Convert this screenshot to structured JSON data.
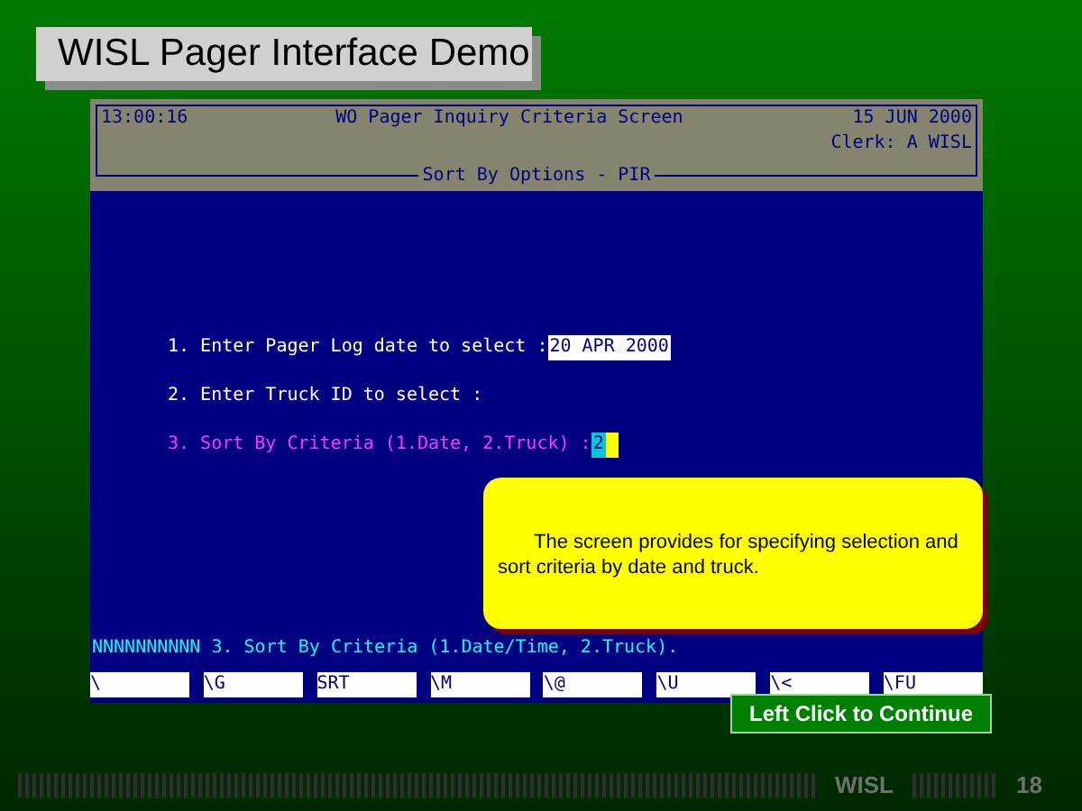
{
  "slide_title": "WISL Pager Interface Demo",
  "terminal": {
    "time": "13:00:16",
    "title": "WO Pager Inquiry Criteria Screen",
    "date": "15 JUN 2000",
    "clerk": "Clerk: A WISL",
    "section": "Sort By Options - PIR",
    "prompts": [
      {
        "label": "1. Enter Pager Log date to select :",
        "value": "20 APR 2000",
        "active": false
      },
      {
        "label": "2. Enter Truck ID to select :",
        "active": false
      },
      {
        "label": "3. Sort By Criteria (1.Date, 2.Truck) :",
        "value": "2",
        "active": true
      }
    ],
    "status_line": "NNNNNNNNNN 3. Sort By Criteria (1.Date/Time, 2.Truck).",
    "function_keys": [
      "\\",
      "\\G",
      "SRT",
      "\\M",
      "\\@",
      "\\U",
      "\\<",
      "\\FU"
    ]
  },
  "callout": "The screen provides for specifying selection and sort criteria by date and truck.",
  "continue_button": "Left Click to Continue",
  "footer": {
    "brand": "WISL",
    "page": "18"
  }
}
